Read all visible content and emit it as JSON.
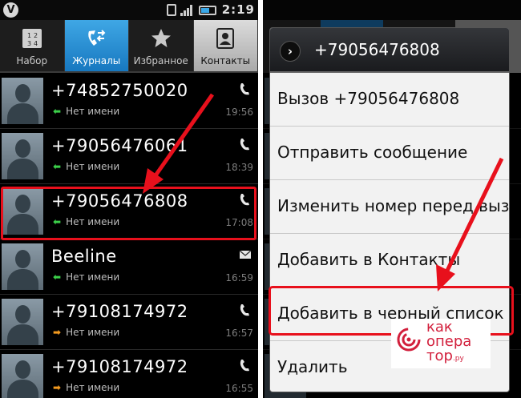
{
  "status_bar": {
    "time": "2:19",
    "logo": "V"
  },
  "tabs": [
    {
      "label": "Набор",
      "icon": "dialpad-icon"
    },
    {
      "label": "Журналы",
      "icon": "call-log-icon",
      "active": true
    },
    {
      "label": "Избранное",
      "icon": "star-icon"
    },
    {
      "label": "Контакты",
      "icon": "contacts-icon"
    }
  ],
  "calls": [
    {
      "name": "+74852750020",
      "status": "Нет имени",
      "time": "19:56",
      "direction": "in",
      "type": "phone-icon"
    },
    {
      "name": "+79056476061",
      "status": "Нет имени",
      "time": "18:39",
      "direction": "in",
      "type": "phone-icon"
    },
    {
      "name": "+79056476808",
      "status": "Нет имени",
      "time": "17:08",
      "direction": "in",
      "type": "phone-icon"
    },
    {
      "name": "Beeline",
      "status": "Нет имени",
      "time": "16:59",
      "direction": "in",
      "type": "envelope-icon"
    },
    {
      "name": "+79108174972",
      "status": "Нет имени",
      "time": "16:57",
      "direction": "out",
      "type": "phone-icon"
    },
    {
      "name": "+79108174972",
      "status": "Нет имени",
      "time": "16:55",
      "direction": "out",
      "type": "phone-icon"
    }
  ],
  "dialog": {
    "title": "+79056476808",
    "items": [
      "Вызов +79056476808",
      "Отправить сообщение",
      "Изменить номер перед вызо",
      "Добавить в Контакты",
      "Добавить в черный список",
      "Удалить"
    ]
  },
  "watermark": {
    "line1": "как",
    "line2": "опера",
    "line3": "тор",
    "suffix": ".ру"
  },
  "colors": {
    "accent_blue": "#1778c0",
    "highlight_red": "#e8101c",
    "incoming_arrow": "#3cd04a",
    "outgoing_arrow": "#f39a1f",
    "brand": "#d21f3c"
  }
}
